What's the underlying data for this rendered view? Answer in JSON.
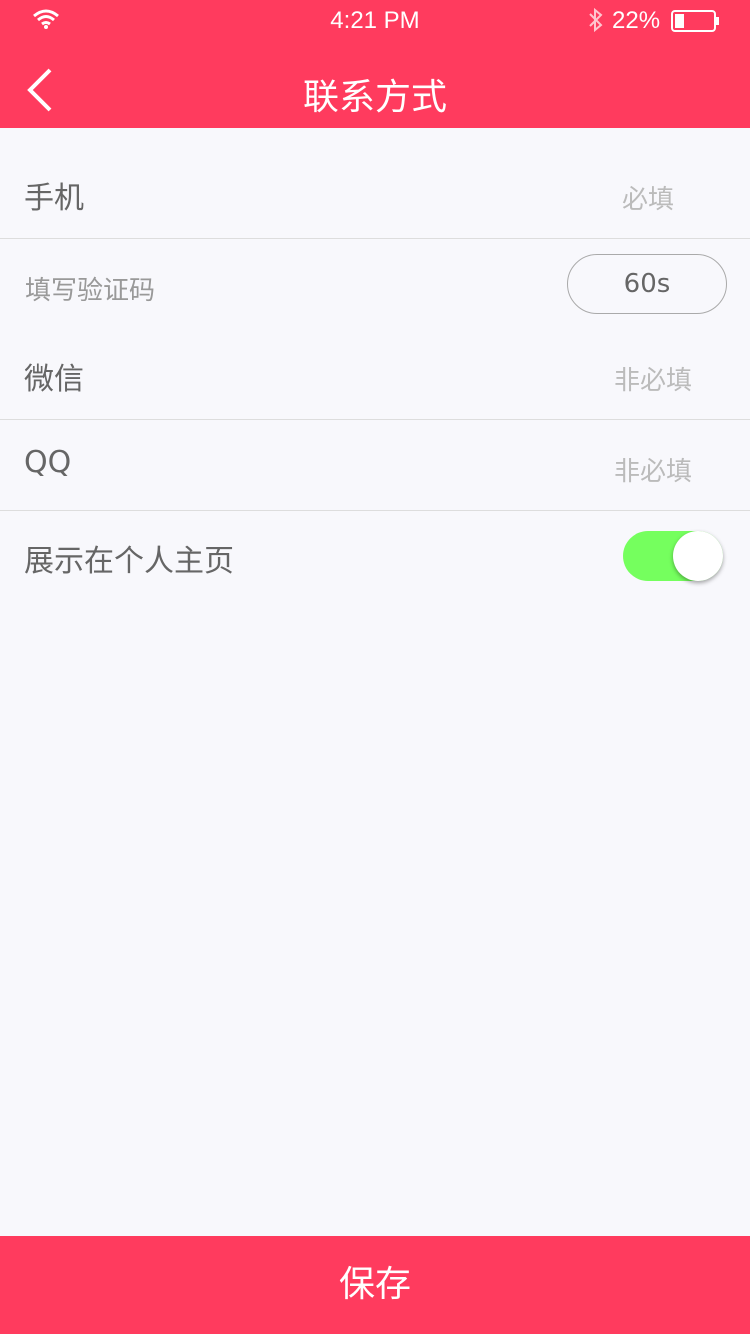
{
  "status_bar": {
    "time": "4:21 PM",
    "battery": "22%"
  },
  "nav": {
    "title": "联系方式"
  },
  "form": {
    "phone": {
      "label": "手机",
      "value": "必填"
    },
    "code": {
      "label": "填写验证码",
      "countdown": "60s"
    },
    "wechat": {
      "label": "微信",
      "value": "非必填"
    },
    "qq": {
      "label": "QQ",
      "value": "非必填"
    },
    "show_profile": {
      "label": "展示在个人主页",
      "enabled": true
    }
  },
  "footer": {
    "save_label": "保存"
  },
  "colors": {
    "brand": "#ff3b5e",
    "page_bg": "#f8f8fc",
    "divider": "#dddddd",
    "toggle_on": "#75ff5e"
  }
}
